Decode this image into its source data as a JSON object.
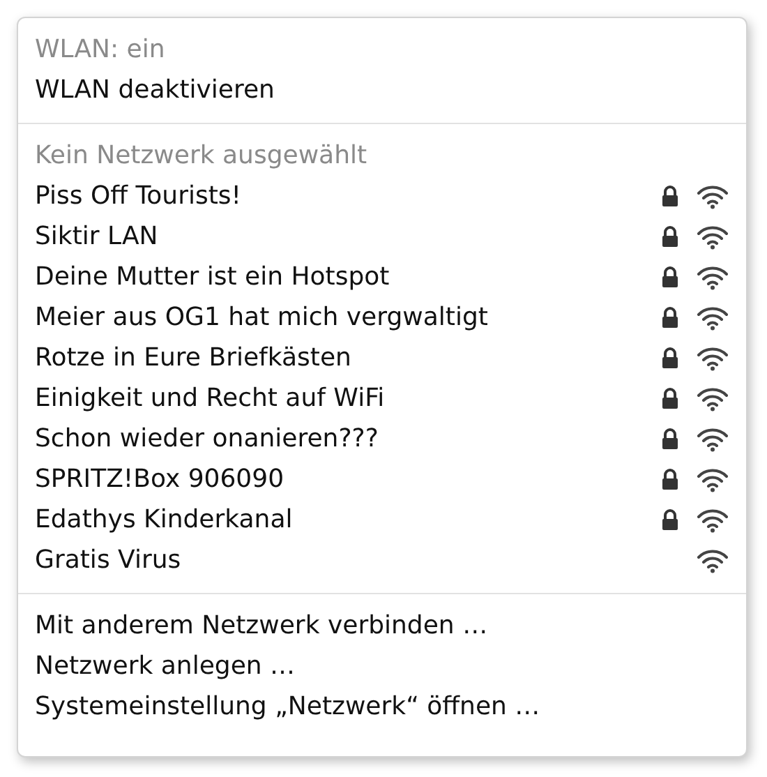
{
  "status": {
    "label": "WLAN: ein"
  },
  "toggle": {
    "label": "WLAN deaktivieren"
  },
  "section_title": "Kein Netzwerk ausgewählt",
  "networks": [
    {
      "name": "Piss Off Tourists!",
      "locked": true
    },
    {
      "name": "Siktir LAN",
      "locked": true
    },
    {
      "name": "Deine Mutter ist ein Hotspot",
      "locked": true
    },
    {
      "name": "Meier aus OG1 hat mich vergwaltigt",
      "locked": true
    },
    {
      "name": "Rotze in Eure Briefkästen",
      "locked": true
    },
    {
      "name": "Einigkeit und Recht auf WiFi",
      "locked": true
    },
    {
      "name": "Schon wieder onanieren???",
      "locked": true
    },
    {
      "name": "SPRITZ!Box 906090",
      "locked": true
    },
    {
      "name": "Edathys Kinderkanal",
      "locked": true
    },
    {
      "name": "Gratis Virus",
      "locked": false
    }
  ],
  "actions": [
    "Mit anderem Netzwerk verbinden …",
    "Netzwerk anlegen …",
    "Systemeinstellung „Netzwerk“ öffnen …"
  ]
}
